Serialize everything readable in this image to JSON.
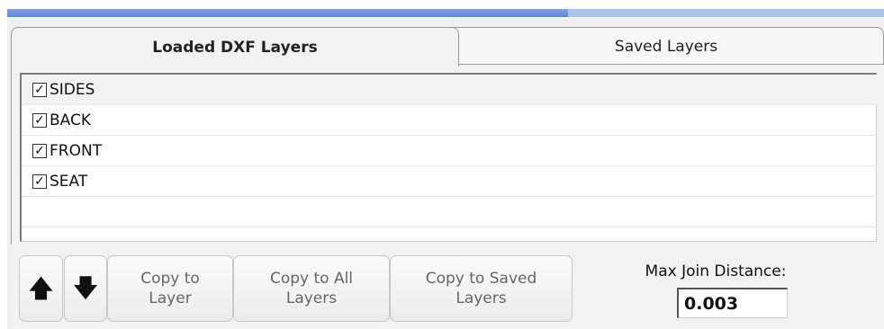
{
  "progress": {
    "fraction": 0.64
  },
  "tabs": {
    "loaded_label": "Loaded DXF Layers",
    "saved_label": "Saved Layers"
  },
  "layers": [
    {
      "name": "SIDES",
      "checked": true
    },
    {
      "name": "BACK",
      "checked": true
    },
    {
      "name": "FRONT",
      "checked": true
    },
    {
      "name": "SEAT",
      "checked": true
    }
  ],
  "buttons": {
    "move_up_icon": "arrow-up",
    "move_down_icon": "arrow-down",
    "copy_to_layer": "Copy to\nLayer",
    "copy_to_all_layers": "Copy to All\nLayers",
    "copy_to_saved_layers": "Copy to Saved\nLayers"
  },
  "max_join": {
    "label": "Max Join Distance:",
    "value": "0.003"
  }
}
